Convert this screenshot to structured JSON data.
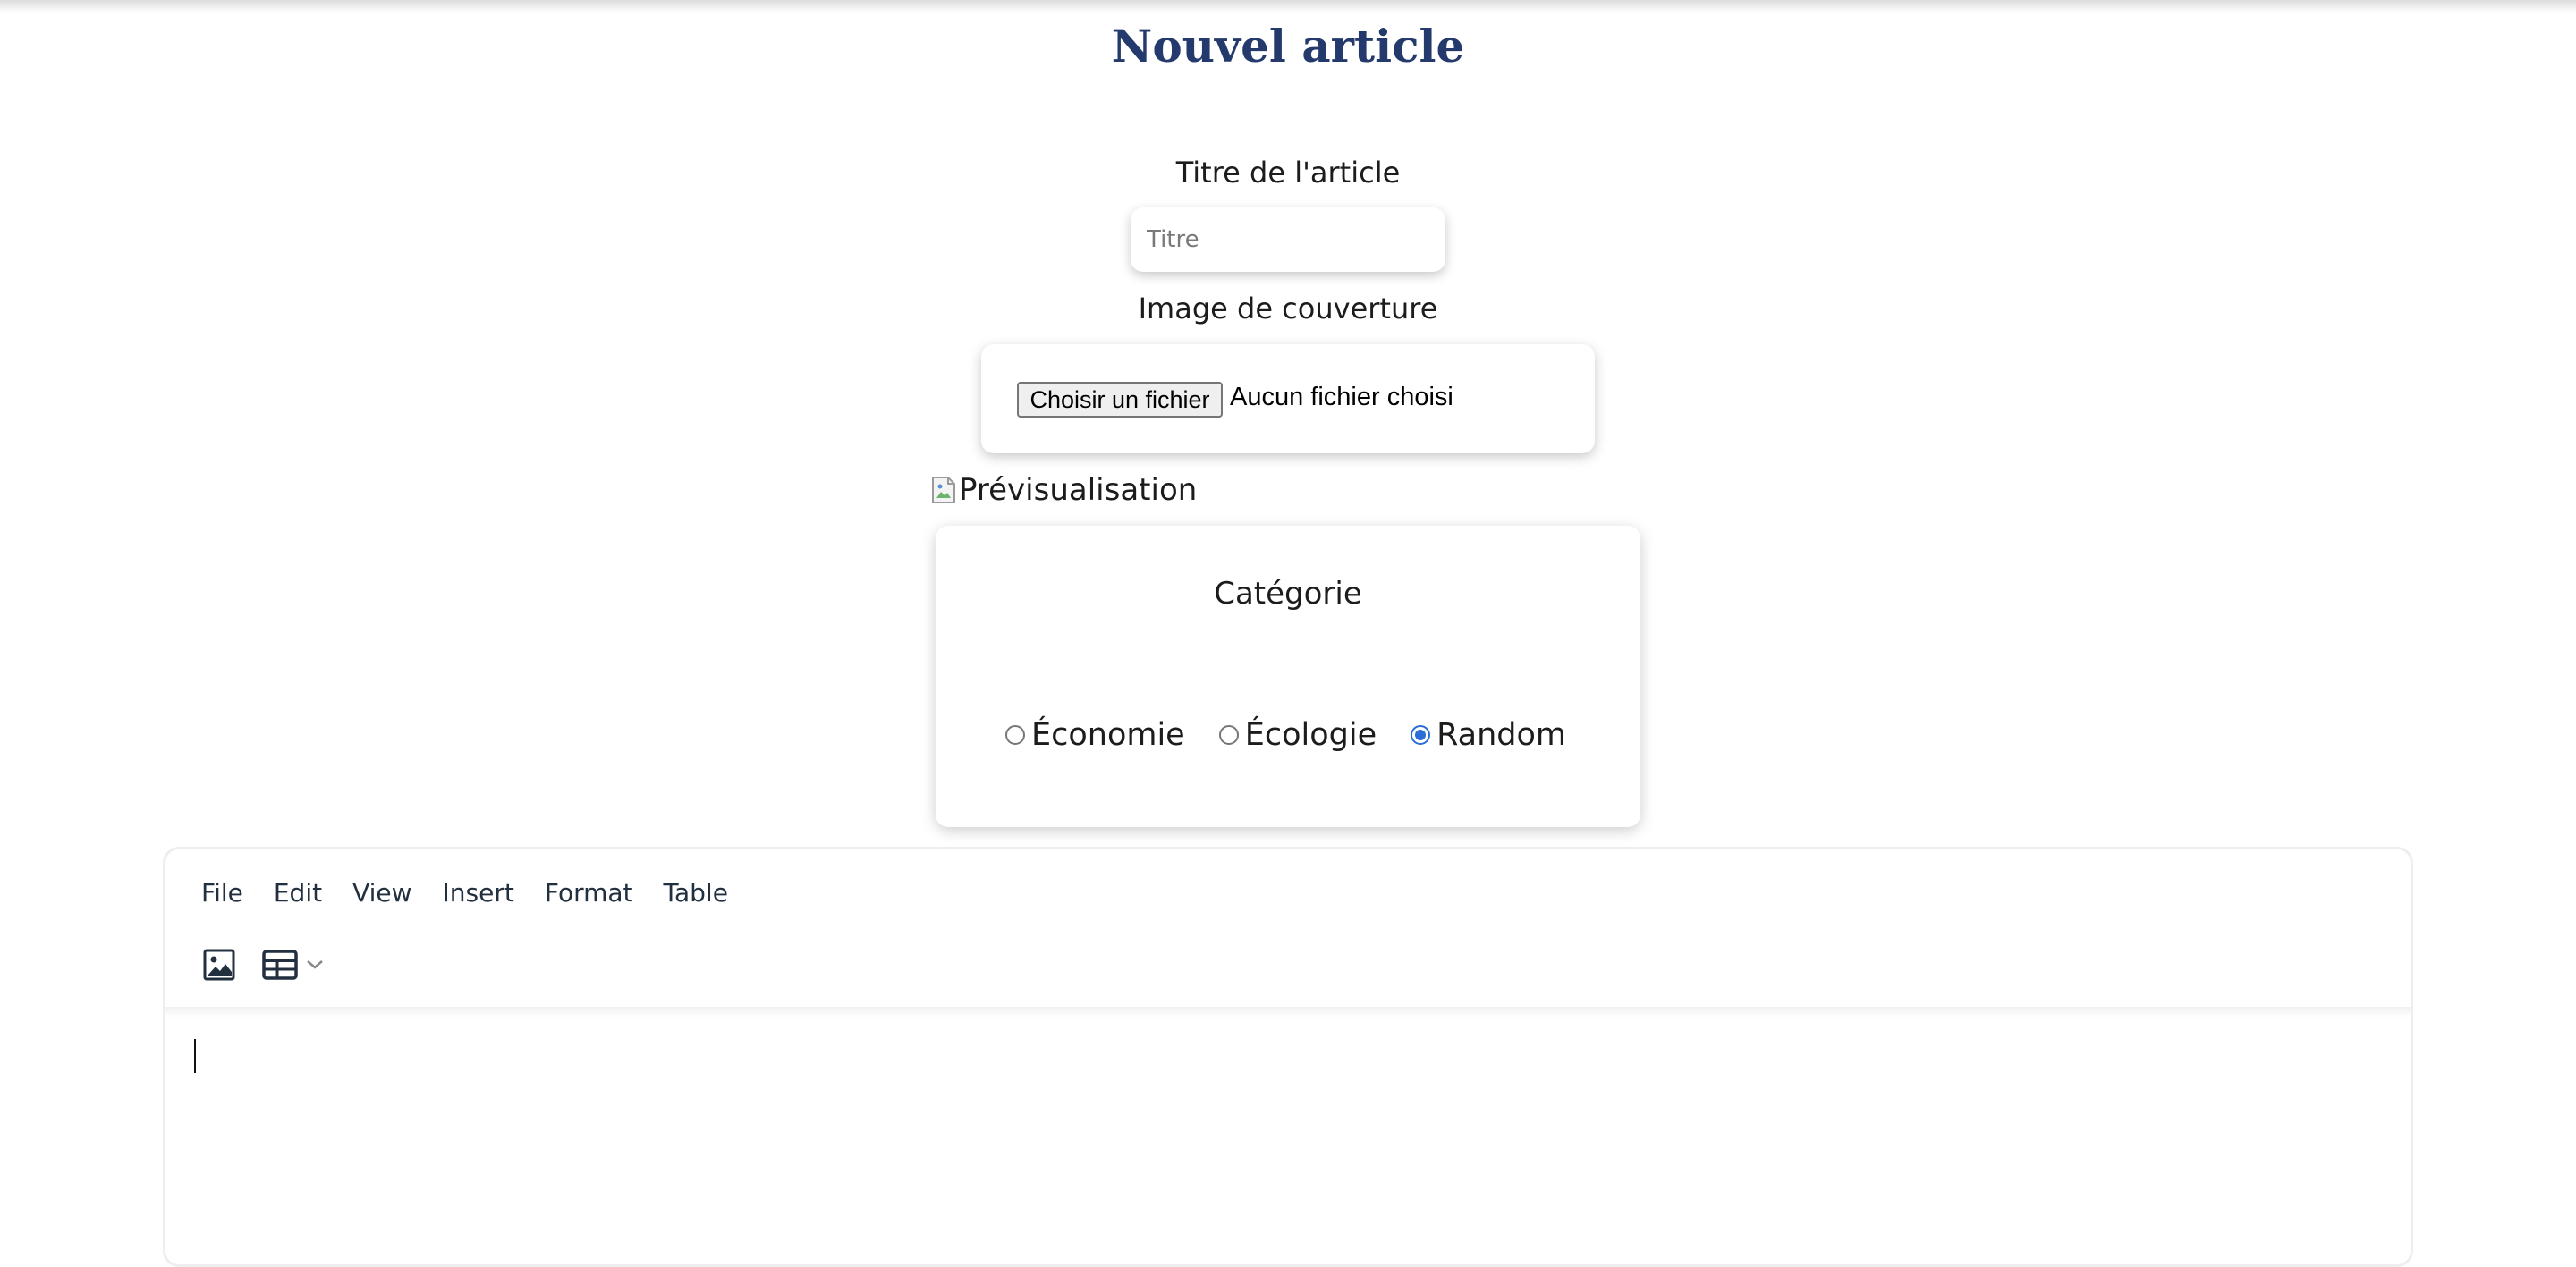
{
  "page": {
    "title": "Nouvel article"
  },
  "form": {
    "title_label": "Titre de l'article",
    "title_placeholder": "Titre",
    "title_value": "",
    "cover_label": "Image de couverture",
    "file_button_label": "Choisir un fichier",
    "file_status": "Aucun fichier choisi",
    "preview_alt": "Prévisualisation"
  },
  "category": {
    "title": "Catégorie",
    "options": [
      {
        "label": "Économie",
        "checked": false
      },
      {
        "label": "Écologie",
        "checked": false
      },
      {
        "label": "Random",
        "checked": true
      }
    ],
    "selected": "Random"
  },
  "editor": {
    "menu": [
      "File",
      "Edit",
      "View",
      "Insert",
      "Format",
      "Table"
    ],
    "toolbar_icons": [
      "image-icon",
      "table-icon",
      "chevron-down-icon"
    ],
    "content": ""
  },
  "colors": {
    "title": "#253a6c",
    "radio_accent": "#2b6fd6",
    "editor_text": "#222f3e"
  }
}
